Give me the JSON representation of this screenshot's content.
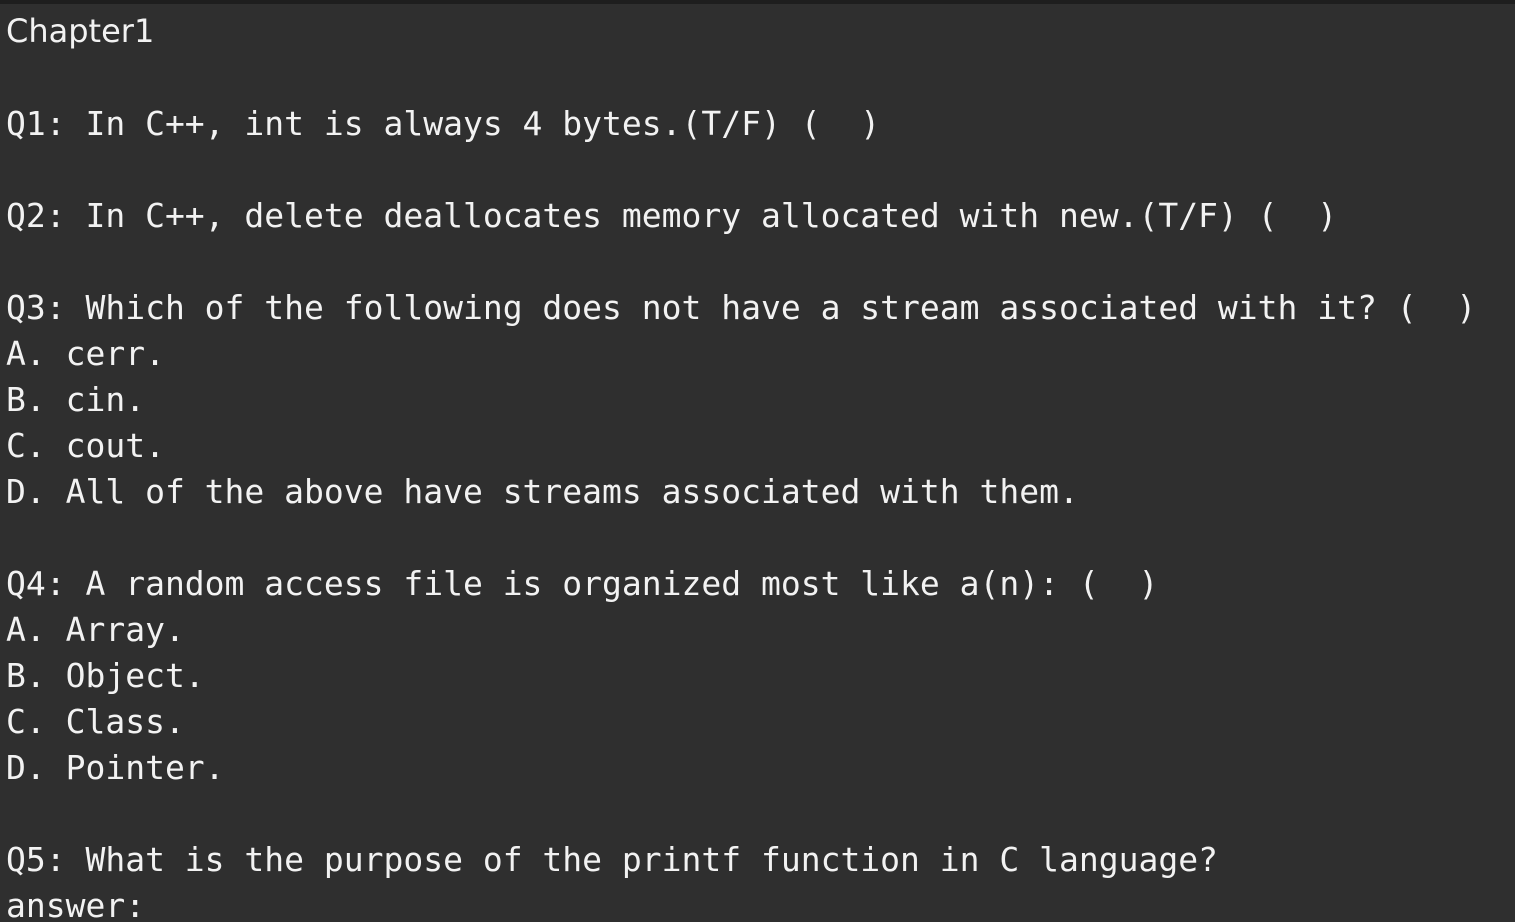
{
  "document": {
    "chapter_title": "Chapter1",
    "lines": [
      "Q1: In C++, int is always 4 bytes.(T/F) (  )",
      "Q2: In C++, delete deallocates memory allocated with new.(T/F) (  )",
      "Q3: Which of the following does not have a stream associated with it? (  )",
      "A. cerr.",
      "B. cin.",
      "C. cout.",
      "D. All of the above have streams associated with them.",
      "Q4: A random access file is organized most like a(n): (  )",
      "A. Array.",
      "B. Object.",
      "C. Class.",
      "D. Pointer.",
      "Q5: What is the purpose of the printf function in C language?",
      "answer:"
    ]
  }
}
